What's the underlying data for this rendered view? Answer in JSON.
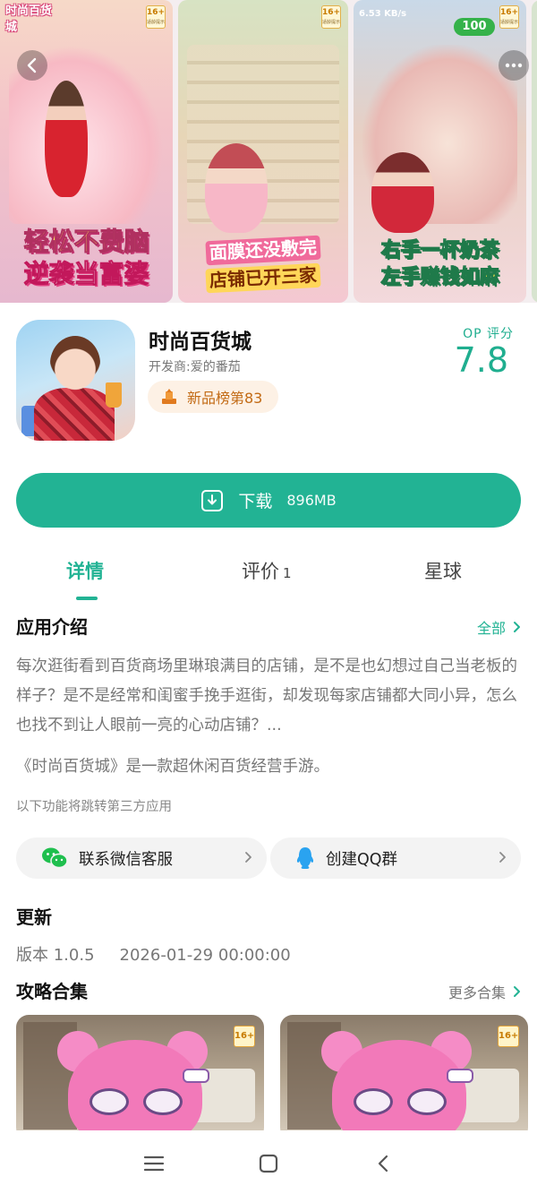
{
  "banner": {
    "screenshots": [
      {
        "logo": "时尚百货城",
        "age": "16+",
        "age_note": "适龄提示",
        "slogan_line1": "轻松不费脑",
        "slogan_line2": "逆袭当富婆"
      },
      {
        "age": "16+",
        "age_note": "适龄提示",
        "slogan_line1": "面膜还没敷完",
        "slogan_line2": "店铺已开三家"
      },
      {
        "speed": "6.53 KB/s",
        "score": "100",
        "age": "16+",
        "age_note": "适龄提示",
        "slogan_line1": "右手一杯奶茶",
        "slogan_line2": "左手赚钱如麻"
      }
    ],
    "back_icon": "chevron-left-icon",
    "more_icon": "more-dots-icon"
  },
  "app": {
    "name": "时尚百货城",
    "developer": "开发商:爱的番茄",
    "rank_badge": "新品榜第83",
    "rank_icon": "rank-trophy-icon",
    "score_label": "OP 评分",
    "score_value": "7.8"
  },
  "download": {
    "label": "下载",
    "size": "896MB",
    "icon": "download-icon"
  },
  "tabs": [
    {
      "label": "详情",
      "active": true
    },
    {
      "label": "评价",
      "count": "1"
    },
    {
      "label": "星球"
    }
  ],
  "intro": {
    "title": "应用介绍",
    "more_label": "全部",
    "text": "每次逛街看到百货商场里琳琅满目的店铺，是不是也幻想过自己当老板的样子？是不是经常和闺蜜手挽手逛街，却发现每家店铺都大同小异，怎么也找不到让人眼前一亮的心动店铺？...",
    "text2": "《时尚百货城》是一款超休闲百货经营手游。",
    "third_party_note": "以下功能将跳转第三方应用"
  },
  "contacts": [
    {
      "label": "联系微信客服",
      "icon": "wechat-icon"
    },
    {
      "label": "创建QQ群",
      "icon": "qq-icon"
    }
  ],
  "update": {
    "title": "更新",
    "version": "版本 1.0.5",
    "date": "2026-01-29 00:00:00"
  },
  "guides": {
    "title": "攻略合集",
    "more_label": "更多合集",
    "cards": [
      {
        "age": "16+"
      },
      {
        "age": "16+"
      }
    ]
  },
  "colors": {
    "accent": "#22b394",
    "rank_bg": "#fdf1e5",
    "rank_text": "#c26a14"
  },
  "system_nav": {
    "menu_icon": "menu-icon",
    "home_icon": "home-square-icon",
    "back_icon": "back-chevron-icon"
  }
}
